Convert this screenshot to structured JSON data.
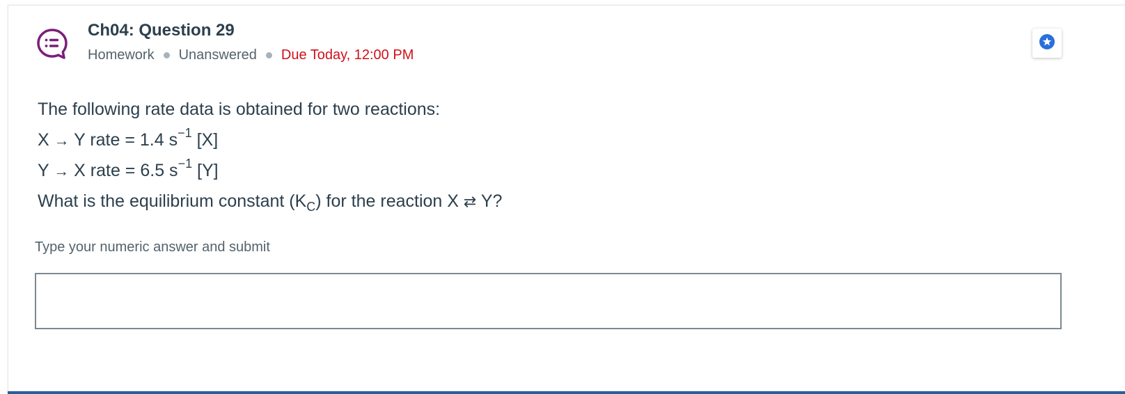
{
  "header": {
    "title": "Ch04: Question 29",
    "type": "Homework",
    "status": "Unanswered",
    "due": "Due Today, 12:00 PM"
  },
  "question": {
    "intro": "The following rate data is obtained for two reactions:",
    "reaction1": {
      "reactant": "X",
      "product": "Y",
      "rate_prefix": "rate = 1.4 s",
      "exponent": "−1",
      "conc": "[X]"
    },
    "reaction2": {
      "reactant": "Y",
      "product": "X",
      "rate_prefix": "rate = 6.5 s",
      "exponent": "−1",
      "conc": "[Y]"
    },
    "prompt_start": "What is the equilibrium constant (K",
    "prompt_sub": "C",
    "prompt_end_1": ") for the reaction X",
    "prompt_end_2": "Y?"
  },
  "answer": {
    "label": "Type your numeric answer and submit",
    "value": "",
    "placeholder": ""
  },
  "colors": {
    "icon": "#7a1f7a",
    "title": "#2c3f4d",
    "meta": "#53626d",
    "due": "#d0101a",
    "star_accent": "#2a6fdb",
    "bottom_rule": "#2a5d9a"
  },
  "icons": {
    "question_type": "list-speech-bubble-icon",
    "star": "star-badge-icon",
    "right_arrow": "right-arrow-icon",
    "equilibrium": "equilibrium-arrows-icon"
  }
}
